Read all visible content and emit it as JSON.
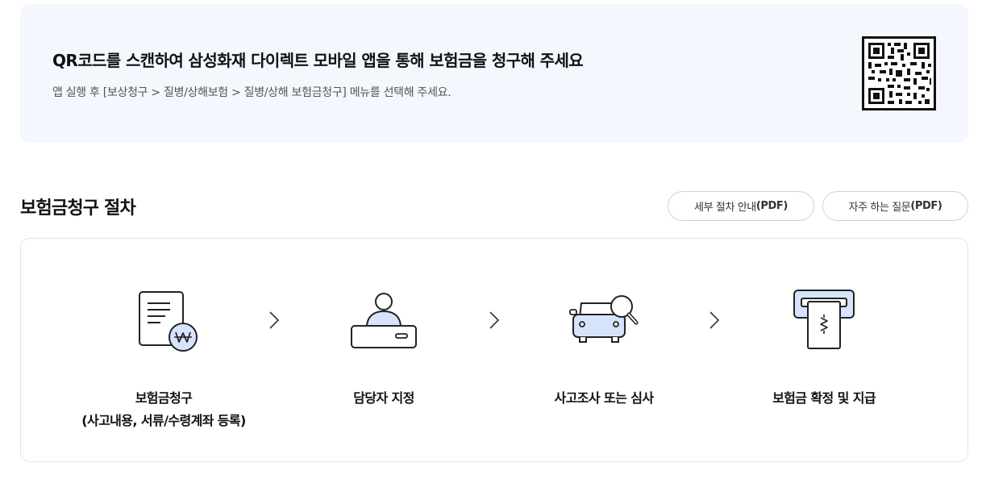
{
  "qr_banner": {
    "title": "QR코드를 스캔하여 삼성화재 다이렉트 모바일 앱을 통해 보험금을 청구해 주세요",
    "description": "앱 실행 후 [보상청구 > 질병/상해보험 > 질병/상해 보험금청구] 메뉴를 선택해 주세요."
  },
  "section": {
    "title": "보험금청구 절차",
    "buttons": [
      {
        "prefix": "세부 절차 안내",
        "suffix": "(PDF)"
      },
      {
        "prefix": "자주 하는 질문",
        "suffix": "(PDF)"
      }
    ]
  },
  "steps": [
    {
      "icon": "document-won-icon",
      "label_line1": "보험금청구",
      "label_line2": "(사고내용, 서류/수령계좌 등록)"
    },
    {
      "icon": "person-desk-icon",
      "label_line1": "담당자 지정",
      "label_line2": ""
    },
    {
      "icon": "car-magnifier-icon",
      "label_line1": "사고조사 또는 심사",
      "label_line2": ""
    },
    {
      "icon": "cash-dispense-icon",
      "label_line1": "보험금 확정 및 지급",
      "label_line2": ""
    }
  ],
  "colors": {
    "banner_bg": "#f4f7fd",
    "icon_fill": "#d6e4fb",
    "icon_stroke": "#222222",
    "border": "#e3e6ea"
  }
}
